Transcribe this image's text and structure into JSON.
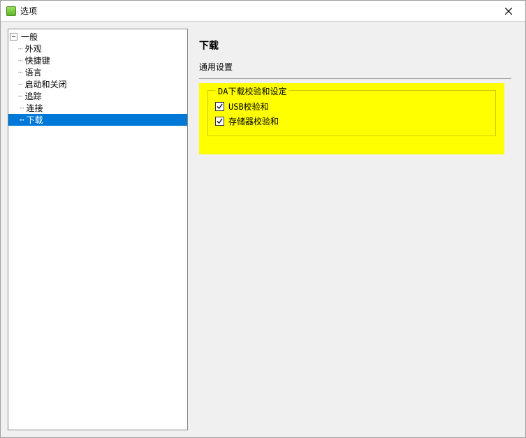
{
  "window": {
    "title": "选项"
  },
  "tree": {
    "general": {
      "label": "一般",
      "children": {
        "appearance": "外观",
        "shortcuts": "快捷键",
        "language": "语言",
        "startup": "启动和关闭",
        "tracking": "追踪"
      }
    },
    "connection": {
      "label": "连接"
    },
    "download": {
      "label": "下载",
      "selected": true
    }
  },
  "panel": {
    "title": "下载",
    "subsection": "通用设置",
    "group": {
      "legend": "DA下载校验和设定",
      "usb_checksum": {
        "label": "USB校验和",
        "checked": true
      },
      "storage_checksum": {
        "label": "存储器校验和",
        "checked": true
      }
    }
  },
  "colors": {
    "selection": "#0078d7",
    "highlight": "#ffff00"
  }
}
